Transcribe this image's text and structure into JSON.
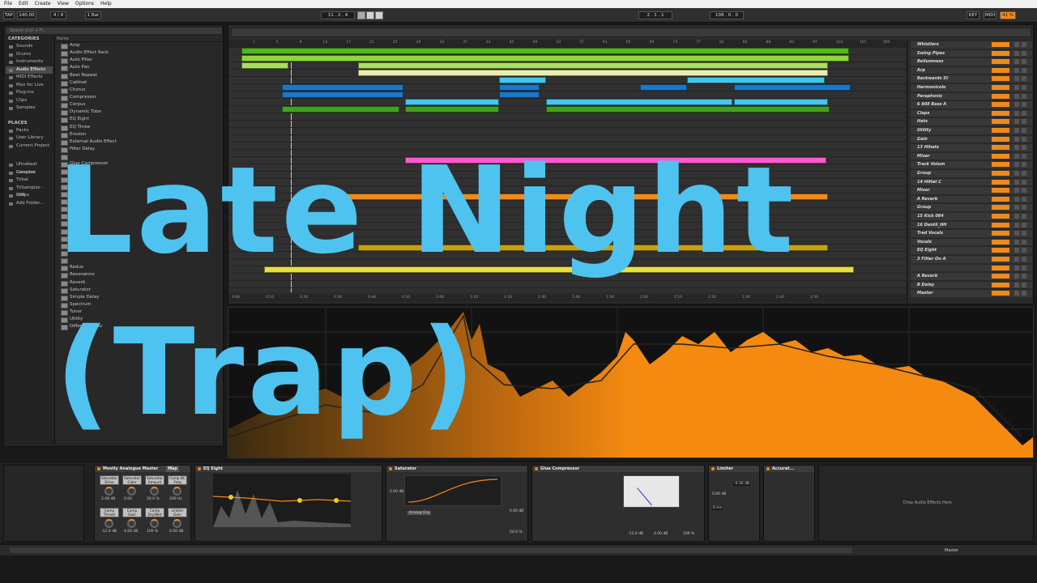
{
  "menu": [
    "File",
    "Edit",
    "Create",
    "View",
    "Options",
    "Help"
  ],
  "transport": {
    "tap": "TAP",
    "tempo": "140.00",
    "sig": "4 / 4",
    "quant": "1 Bar",
    "pos": "11 . 2 . 4",
    "loop_start": "2 . 1 . 1",
    "loop_len": "108 . 0 . 0",
    "key": "KEY",
    "midi": "MIDI",
    "cpu": "41 %"
  },
  "browser": {
    "search_placeholder": "Search (Ctrl + F)",
    "categories_title": "CATEGORIES",
    "categories": [
      "Sounds",
      "Drums",
      "Instruments",
      "Audio Effects",
      "MIDI Effects",
      "Max for Live",
      "Plug-ins",
      "Clips",
      "Samples"
    ],
    "places_title": "PLACES",
    "places": [
      "Packs",
      "User Library",
      "Current Project",
      "Ultrabeat Samples",
      "Classical",
      "Tribal",
      "TriSamples - 808",
      "Loops",
      "Add Folder..."
    ],
    "name_header": "Name",
    "items": [
      "Amp",
      "Audio Effect Rack",
      "Auto Filter",
      "Auto Pan",
      "Beat Repeat",
      "Cabinet",
      "Chorus",
      "Compressor",
      "Corpus",
      "Dynamic Tube",
      "EQ Eight",
      "EQ Three",
      "Erosion",
      "External Audio Effect",
      "Filter Delay",
      "",
      "Glue Compressor",
      "",
      "",
      "",
      "",
      "",
      "",
      "",
      "",
      "",
      "",
      "",
      "",
      "",
      "Redux",
      "Resonators",
      "Reverb",
      "Saturator",
      "Simple Delay",
      "Spectrum",
      "Tuner",
      "Utility",
      "Difference.adv"
    ]
  },
  "arrangement": {
    "ruler": [
      "1",
      "5",
      "9",
      "13",
      "17",
      "21",
      "25",
      "29",
      "33",
      "37",
      "41",
      "45",
      "49",
      "53",
      "57",
      "61",
      "65",
      "69",
      "73",
      "77",
      "81",
      "85",
      "89",
      "93",
      "97",
      "101",
      "105",
      "109",
      "113"
    ],
    "times": [
      "0:00",
      "0:10",
      "0:20",
      "0:30",
      "0:40",
      "0:50",
      "1:00",
      "1:10",
      "1:20",
      "1:30",
      "1:40",
      "1:50",
      "2:00",
      "2:10",
      "2:20",
      "2:30",
      "2:40",
      "2:50"
    ]
  },
  "tracks": [
    "Whistlers",
    "Swing Pipes",
    "Bellumness",
    "Arp",
    "Backwards St",
    "Harmonicolo",
    "Paraphonic",
    "6 808 Bass A",
    "Claps",
    "Hats",
    "Utility",
    "Gain",
    "13 Hihats",
    "Mixer",
    "Track Volum",
    "Group",
    "14 HiHat C",
    "Mixer",
    "A Reverb",
    "Group",
    "15 Kick 084",
    "16 Dentii_HH",
    "Trad Vocals",
    "Vocals",
    "EQ Eight",
    "3 Filter On A",
    "",
    "A Reverb",
    "B Delay",
    "Master"
  ],
  "devices": {
    "d1": "Mostly Analogue Master",
    "d1_buttons": [
      "Saturator Drive",
      "Saturator Color",
      "Saturator Amount",
      "Comp BC Freq",
      "Comp Thresh",
      "Comp Gain",
      "Comp Dry/Wet",
      "Limiter Gain"
    ],
    "d1_values": [
      "2.08 dB",
      "0.00",
      "50.0 %",
      "200 Hz",
      "-12.0 dB",
      "4.00 dB",
      "100 %",
      "0.00 dB"
    ],
    "map": "Map",
    "d2": "EQ Eight",
    "d3": "Saturator",
    "d3_values": {
      "drive": "2.00 dB",
      "mode": "Analog Clip",
      "output": "0.00 dB",
      "drywet": "50.0 %"
    },
    "d4": "Glue Compressor",
    "d4_values": {
      "threshold": "-12.0 dB",
      "makeup": "4.00 dB",
      "drywet": "100 %"
    },
    "d5": "Limiter",
    "d5_values": {
      "gain": "0.00 dB",
      "ceiling": "-0.30 dB",
      "lookahead": "6 ms"
    },
    "d6": "Accurat...",
    "drop": "Drop Audio Effects Here",
    "master": "Master"
  },
  "overlay": {
    "line1": "Late Night",
    "line2": "(Trap)"
  },
  "colors": {
    "accent": "#f08a1c",
    "overlay": "#4fc3ef"
  }
}
